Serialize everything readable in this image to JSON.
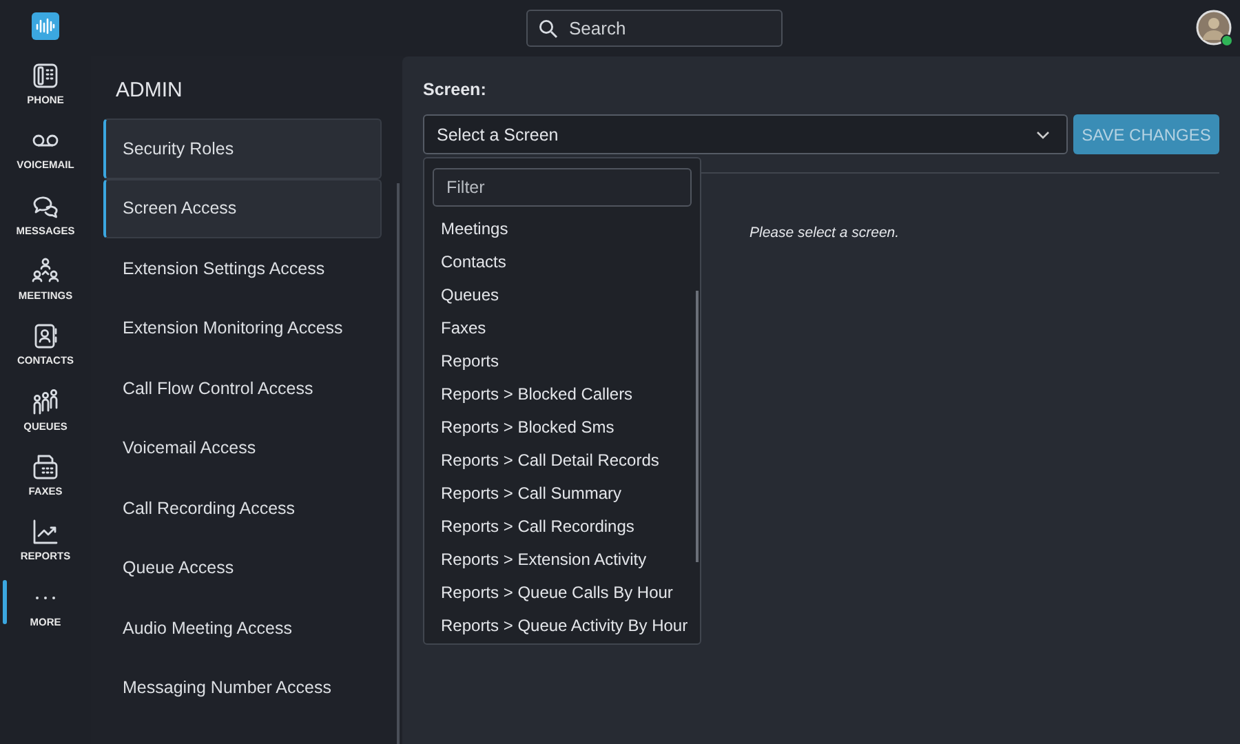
{
  "topbar": {
    "search": {
      "placeholder": "Search"
    },
    "avatar": {
      "online": true
    }
  },
  "nav": [
    {
      "label": "PHONE",
      "selected": false
    },
    {
      "label": "VOICEMAIL",
      "selected": false
    },
    {
      "label": "MESSAGES",
      "selected": false
    },
    {
      "label": "MEETINGS",
      "selected": false
    },
    {
      "label": "CONTACTS",
      "selected": false
    },
    {
      "label": "QUEUES",
      "selected": false
    },
    {
      "label": "FAXES",
      "selected": false
    },
    {
      "label": "REPORTS",
      "selected": false
    },
    {
      "label": "MORE",
      "selected": true
    }
  ],
  "admin": {
    "title": "ADMIN",
    "items": [
      {
        "label": "Security Roles",
        "selected": true
      },
      {
        "label": "Screen Access",
        "selected": true
      },
      {
        "label": "Extension Settings Access",
        "selected": false
      },
      {
        "label": "Extension Monitoring Access",
        "selected": false
      },
      {
        "label": "Call Flow Control Access",
        "selected": false
      },
      {
        "label": "Voicemail Access",
        "selected": false
      },
      {
        "label": "Call Recording Access",
        "selected": false
      },
      {
        "label": "Queue Access",
        "selected": false
      },
      {
        "label": "Audio Meeting Access",
        "selected": false
      },
      {
        "label": "Messaging Number Access",
        "selected": false
      }
    ]
  },
  "main": {
    "label": "Screen:",
    "select": {
      "value": "Select a Screen",
      "expanded": true
    },
    "save_button": {
      "label": "SAVE CHANGES",
      "disabled": true
    },
    "message": "Please select a screen.",
    "dropdown": {
      "filter": {
        "placeholder": "Filter"
      },
      "options": [
        "Meetings",
        "Contacts",
        "Queues",
        "Faxes",
        "Reports",
        "Reports > Blocked Callers",
        "Reports > Blocked Sms",
        "Reports > Call Detail Records",
        "Reports > Call Summary",
        "Reports > Call Recordings",
        "Reports > Extension Activity",
        "Reports > Queue Calls By Hour",
        "Reports > Queue Activity By Hour"
      ]
    }
  }
}
